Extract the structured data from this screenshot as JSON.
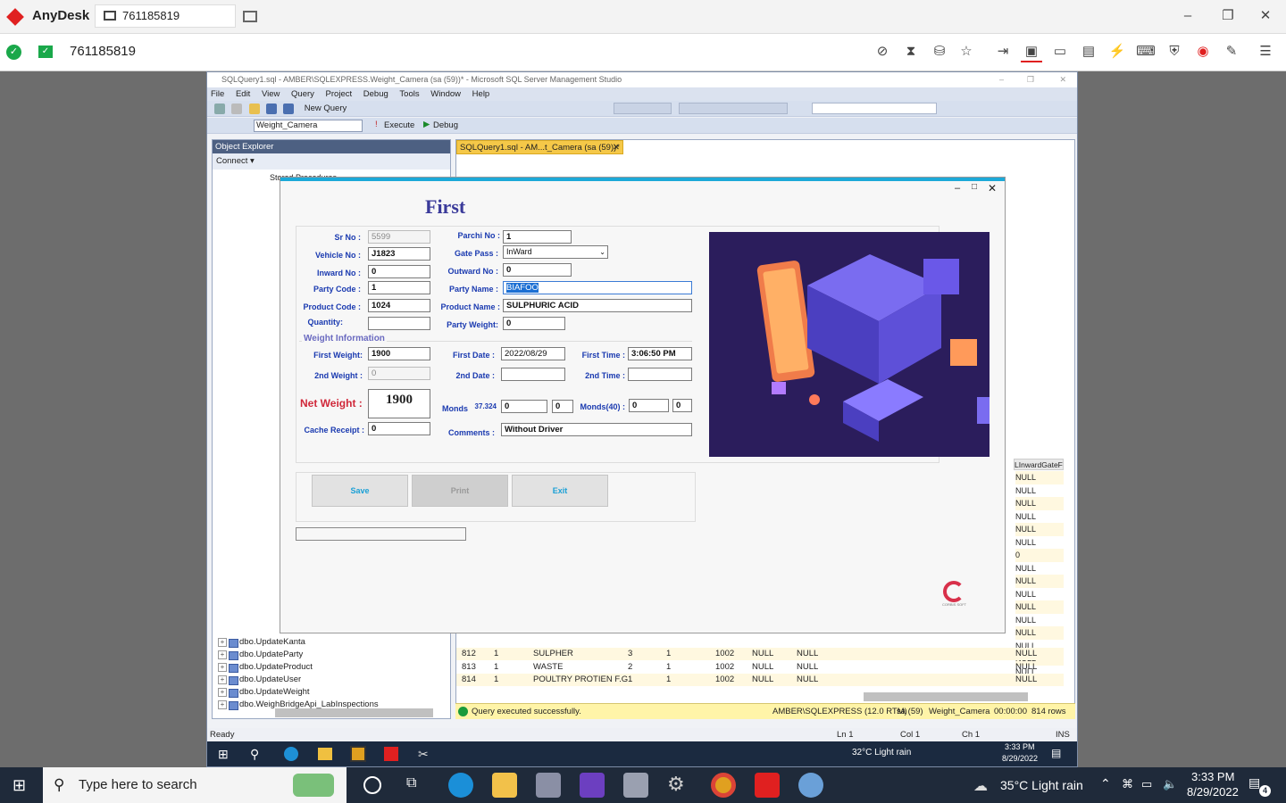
{
  "anydesk": {
    "app_name": "AnyDesk",
    "tab_id": "761185819",
    "address": "761185819"
  },
  "ssms": {
    "title": "SQLQuery1.sql - AMBER\\SQLEXPRESS.Weight_Camera (sa (59))* - Microsoft SQL Server Management Studio",
    "menu": [
      "File",
      "Edit",
      "View",
      "Query",
      "Project",
      "Debug",
      "Tools",
      "Window",
      "Help"
    ],
    "new_query": "New Query",
    "database": "Weight_Camera",
    "execute": "Execute",
    "debug": "Debug",
    "object_explorer": "Object Explorer",
    "connect": "Connect ▾",
    "stored_procedures": "Stored Procedures",
    "tree_items": [
      "dbo.UpdateKanta",
      "dbo.UpdateParty",
      "dbo.UpdateProduct",
      "dbo.UpdateUser",
      "dbo.UpdateWeight",
      "dbo.WeighBridgeApi_LabInspections"
    ],
    "doc_tab": "SQLQuery1.sql - AM...t_Camera (sa (59))*",
    "result_col_header": "LInwardGateF",
    "null_column": [
      "NULL",
      "NULL",
      "NULL",
      "NULL",
      "NULL",
      "NULL",
      "0",
      "NULL",
      "NULL",
      "NULL",
      "NULL",
      "NULL",
      "NULL",
      "NULL",
      "NULL",
      "NULL"
    ],
    "rows": [
      {
        "id": "812",
        "a": "1",
        "name": "SULPHER",
        "b": "3",
        "c": "1",
        "code": "1002",
        "n1": "NULL",
        "n2": "NULL",
        "last": "NULL"
      },
      {
        "id": "813",
        "a": "1",
        "name": "WASTE",
        "b": "2",
        "c": "1",
        "code": "1002",
        "n1": "NULL",
        "n2": "NULL",
        "last": "NULL"
      },
      {
        "id": "814",
        "a": "1",
        "name": "POULTRY PROTIEN F.G",
        "b": "1",
        "c": "1",
        "code": "1002",
        "n1": "NULL",
        "n2": "NULL",
        "last": "NULL"
      }
    ],
    "status_msg": "Query executed successfully.",
    "status_server": "AMBER\\SQLEXPRESS (12.0 RTM)",
    "status_user": "sa (59)",
    "status_db": "Weight_Camera",
    "status_time": "00:00:00",
    "status_rows": "814 rows",
    "ready": "Ready",
    "ln": "Ln 1",
    "col": "Col 1",
    "ch": "Ch 1",
    "ins": "INS",
    "inner_weather": "32°C  Light rain",
    "inner_time": "3:33 PM",
    "inner_date": "8/29/2022"
  },
  "dialog": {
    "title": "First",
    "sr_no_label": "Sr No :",
    "sr_no": "5599",
    "vehicle_label": "Vehicle No :",
    "vehicle": "J1823",
    "inward_label": "Inward No :",
    "inward": "0",
    "party_code_label": "Party Code :",
    "party_code": "1",
    "product_code_label": "Product Code :",
    "product_code": "1024",
    "quantity_label": "Quantity:",
    "quantity": "",
    "parchi_label": "Parchi No :",
    "parchi": "1",
    "gate_pass_label": "Gate Pass :",
    "gate_pass": "InWard",
    "outward_label": "Outward No :",
    "outward": "0",
    "party_name_label": "Party Name :",
    "party_name": "BIAFOO",
    "product_name_label": "Product Name :",
    "product_name": "SULPHURIC ACID",
    "party_weight_label": "Party  Weight:",
    "party_weight": "0",
    "weight_info": "Weight Information",
    "first_weight_label": "First  Weight:",
    "first_weight": "1900",
    "second_weight_label": "2nd Weight :",
    "second_weight": "0",
    "first_date_label": "First Date :",
    "first_date": "2022/08/29",
    "second_date_label": "2nd Date :",
    "second_date": "",
    "first_time_label": "First Time :",
    "first_time": "3:06:50 PM",
    "second_time_label": "2nd Time :",
    "second_time": "",
    "net_weight_label": "Net Weight :",
    "net_weight": "1900",
    "monds_label": "Monds",
    "monds_factor": "37.324",
    "monds": "0",
    "monds2": "0",
    "monds40_label": "Monds(40) :",
    "monds40": "0",
    "monds40b": "0",
    "cache_label": "Cache Receipt :",
    "cache": "0",
    "comments_label": "Comments :",
    "comments": "Without Driver",
    "save": "Save",
    "print": "Print",
    "exit": "Exit",
    "brand": "CORBIS SOFT"
  },
  "taskbar": {
    "search": "Type here to search",
    "weather": "35°C  Light rain",
    "time": "3:33 PM",
    "date": "8/29/2022",
    "notif": "4"
  }
}
